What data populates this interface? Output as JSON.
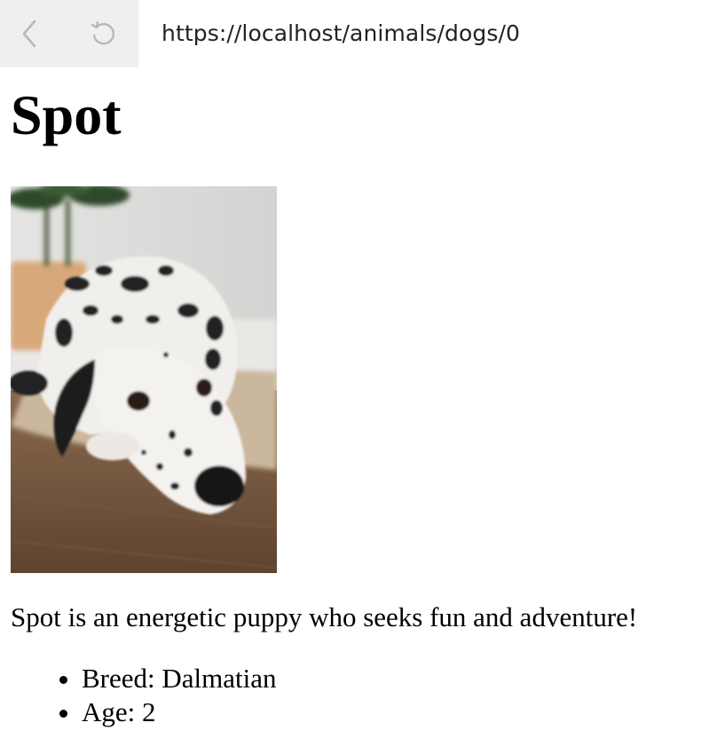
{
  "browser": {
    "url": "https://localhost/animals/dogs/0",
    "back_icon": "chevron-left-icon",
    "reload_icon": "reload-icon"
  },
  "dog": {
    "name": "Spot",
    "photo_icon": "dalmatian-photo",
    "description": "Spot is an energetic puppy who seeks fun and adventure!",
    "details": [
      {
        "text": "Breed: Dalmatian"
      },
      {
        "text": "Age: 2"
      }
    ]
  },
  "colors": {
    "nav_background": "#efefef",
    "icon_gray": "#b8b8b8",
    "text": "#000000"
  }
}
